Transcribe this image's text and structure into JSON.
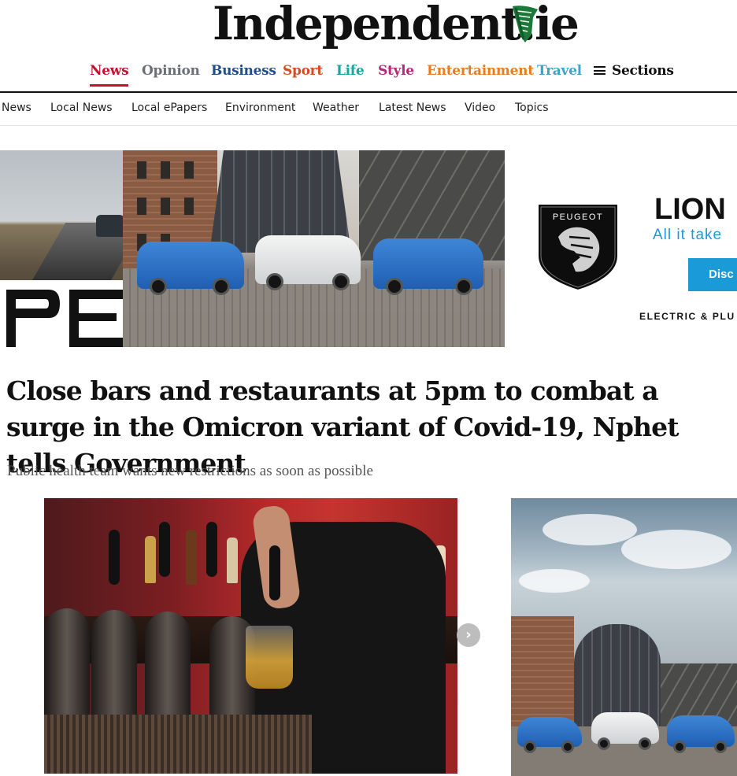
{
  "masthead": {
    "logo_text": "Independent.ie"
  },
  "primary_nav": {
    "items": [
      {
        "label": "News",
        "color": "#c8102e"
      },
      {
        "label": "Opinion",
        "color": "#6b7078"
      },
      {
        "label": "Business",
        "color": "#1f4e8c"
      },
      {
        "label": "Sport",
        "color": "#d94a1f"
      },
      {
        "label": "Life",
        "color": "#1ba5a0"
      },
      {
        "label": "Style",
        "color": "#b5287a"
      },
      {
        "label": "Entertainment",
        "color": "#e67d22"
      },
      {
        "label": "Travel",
        "color": "#3fa3c9"
      }
    ],
    "sections_label": "Sections"
  },
  "secondary_nav": {
    "items": [
      "News",
      "Local News",
      "Local ePapers",
      "Environment",
      "Weather",
      "Latest News",
      "Video",
      "Topics"
    ]
  },
  "ad_banner": {
    "brand": "PEUGEOT",
    "title": "LION",
    "subtitle": "All it take",
    "cta": "Disc",
    "tagline": "ELECTRIC & PLU",
    "accent": "#1a9ad6"
  },
  "article": {
    "headline": "Close bars and restaurants at 5pm to combat a surge in the Omicron variant of Covid-19, Nphet tells Government",
    "standfirst": "Public health team wants new restrictions as soon as possible"
  },
  "carousel": {
    "next_icon": "chevron-right-icon",
    "next_glyph": "›"
  }
}
